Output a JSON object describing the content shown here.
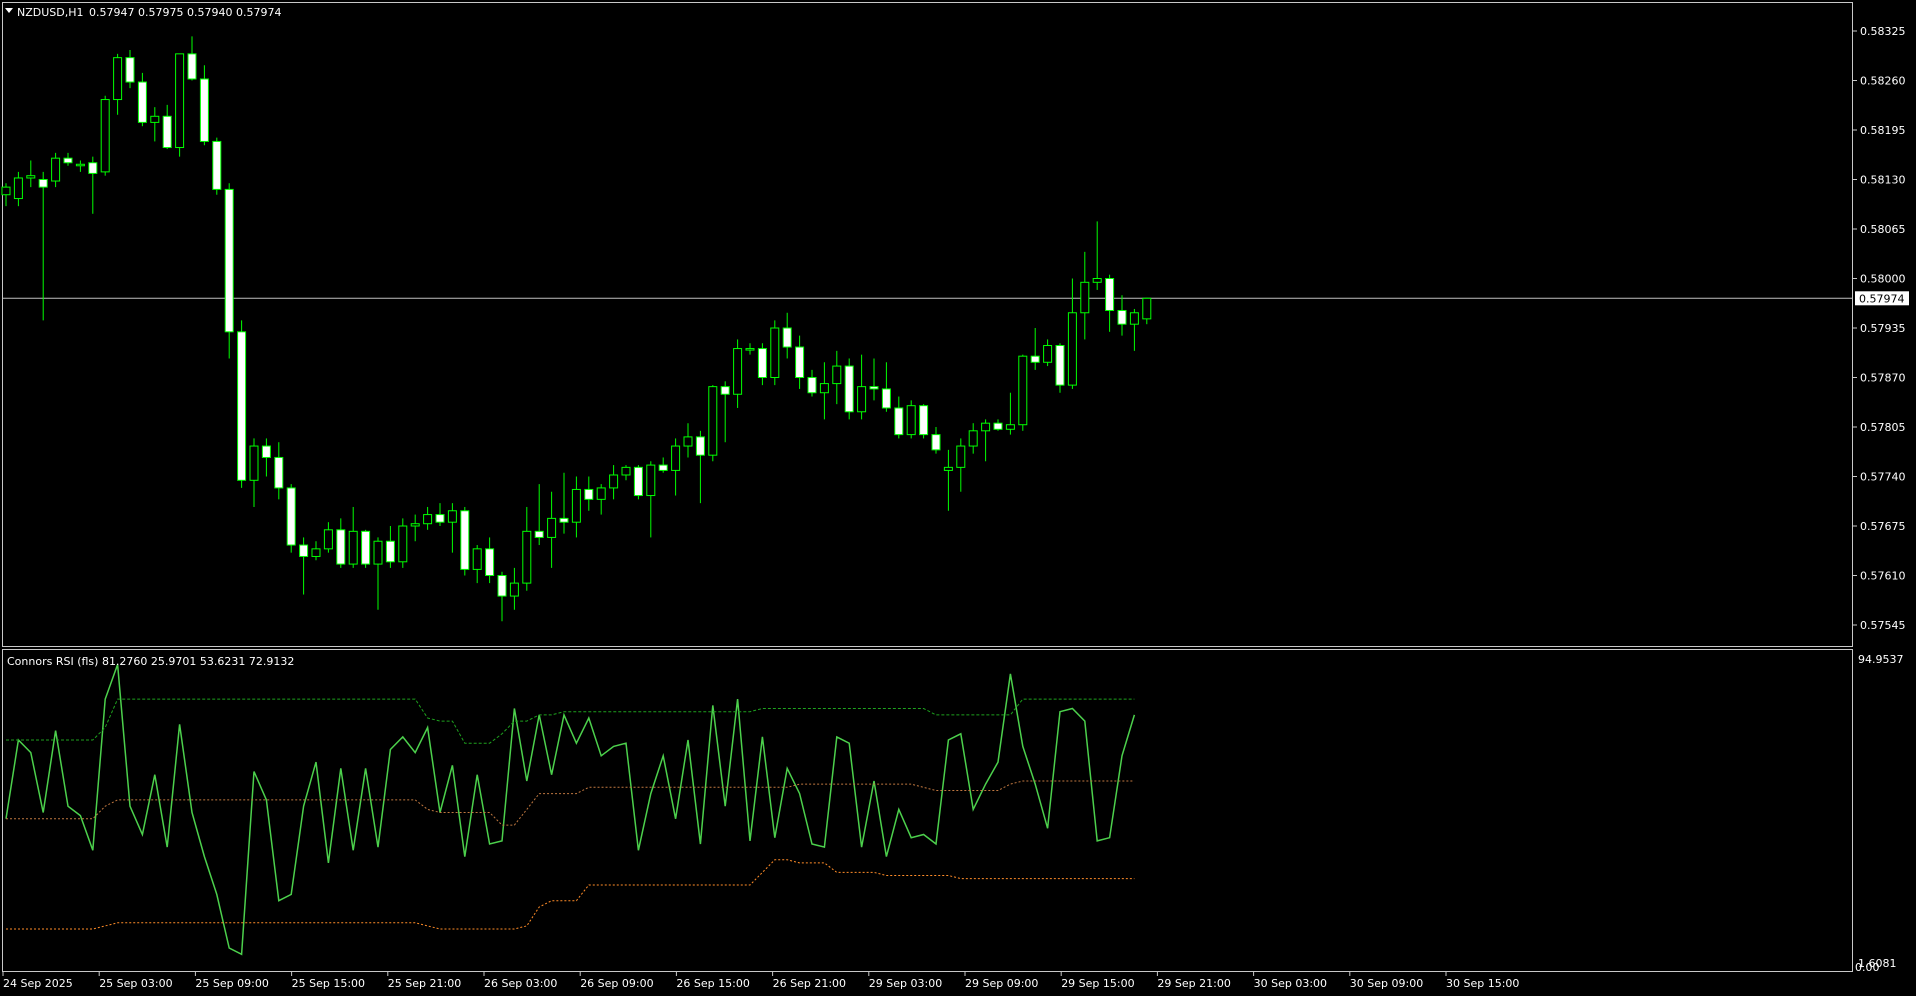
{
  "header": {
    "symbol_label": "NZDUSD,H1",
    "ohlc_label": "0.57947 0.57975 0.57940 0.57974",
    "dropdown_icon": "triangle-down-icon"
  },
  "indicator": {
    "label": "Connors RSI (fls) 81.2760 25.9701 53.6231 72.9132",
    "axis_max_label": "94.9537",
    "axis_min_label": "1.6081",
    "axis_zero_label": "0.00"
  },
  "colors": {
    "background": "#000000",
    "candle": "#00ff00",
    "bull_body": "#000000",
    "bear_body": "#ffffff",
    "frame": "#c8c8c8",
    "current_price_line": "#c0c0c0",
    "rsi_line": "#4cd04c",
    "upper_band": "#1ea01e",
    "mid_band": "#c07840",
    "lower_band": "#ff8c28"
  },
  "chart_data": [
    {
      "type": "candlestick",
      "title": "NZDUSD,H1",
      "y_ticks": [
        "0.58325",
        "0.58260",
        "0.58195",
        "0.58130",
        "0.58065",
        "0.58000",
        "0.57935",
        "0.57870",
        "0.57805",
        "0.57740",
        "0.57675",
        "0.57610",
        "0.57545"
      ],
      "current_price_label": "0.57974",
      "current_price": 0.57974,
      "x_ticks": [
        "24 Sep 2025",
        "25 Sep 03:00",
        "25 Sep 09:00",
        "25 Sep 15:00",
        "25 Sep 21:00",
        "26 Sep 03:00",
        "26 Sep 09:00",
        "26 Sep 15:00",
        "26 Sep 21:00",
        "29 Sep 03:00",
        "29 Sep 09:00",
        "29 Sep 15:00",
        "29 Sep 21:00",
        "30 Sep 03:00",
        "30 Sep 09:00",
        "30 Sep 15:00"
      ],
      "ohlc": [
        [
          0.5811,
          0.58125,
          0.58095,
          0.5812
        ],
        [
          0.58105,
          0.5814,
          0.58095,
          0.58132
        ],
        [
          0.58132,
          0.58155,
          0.5812,
          0.58135
        ],
        [
          0.5813,
          0.5814,
          0.57945,
          0.5812
        ],
        [
          0.58128,
          0.58165,
          0.5812,
          0.58158
        ],
        [
          0.58158,
          0.58165,
          0.58148,
          0.58152
        ],
        [
          0.5815,
          0.58155,
          0.5814,
          0.5815
        ],
        [
          0.58152,
          0.5816,
          0.58085,
          0.58138
        ],
        [
          0.5814,
          0.5824,
          0.58135,
          0.58235
        ],
        [
          0.58235,
          0.58295,
          0.58215,
          0.5829
        ],
        [
          0.5829,
          0.583,
          0.5825,
          0.58258
        ],
        [
          0.58258,
          0.5827,
          0.582,
          0.58205
        ],
        [
          0.58205,
          0.58225,
          0.5818,
          0.58213
        ],
        [
          0.58213,
          0.58228,
          0.5817,
          0.58172
        ],
        [
          0.58172,
          0.58295,
          0.5816,
          0.58295
        ],
        [
          0.58295,
          0.58318,
          0.5826,
          0.58262
        ],
        [
          0.58262,
          0.5828,
          0.58175,
          0.5818
        ],
        [
          0.5818,
          0.58185,
          0.5811,
          0.58117
        ],
        [
          0.58117,
          0.58125,
          0.57895,
          0.5793
        ],
        [
          0.5793,
          0.57945,
          0.57725,
          0.57735
        ],
        [
          0.57735,
          0.5779,
          0.577,
          0.5778
        ],
        [
          0.5778,
          0.5779,
          0.5774,
          0.57765
        ],
        [
          0.57765,
          0.57785,
          0.5771,
          0.57725
        ],
        [
          0.57725,
          0.5773,
          0.5764,
          0.5765
        ],
        [
          0.5765,
          0.5766,
          0.57585,
          0.57635
        ],
        [
          0.57635,
          0.57655,
          0.5763,
          0.57645
        ],
        [
          0.57645,
          0.5768,
          0.5764,
          0.5767
        ],
        [
          0.5767,
          0.57685,
          0.5762,
          0.57625
        ],
        [
          0.57625,
          0.577,
          0.5762,
          0.57668
        ],
        [
          0.57668,
          0.5767,
          0.5762,
          0.57625
        ],
        [
          0.57625,
          0.5766,
          0.57565,
          0.57655
        ],
        [
          0.57655,
          0.57675,
          0.5762,
          0.57628
        ],
        [
          0.57628,
          0.57685,
          0.5762,
          0.57675
        ],
        [
          0.57675,
          0.5769,
          0.57655,
          0.57678
        ],
        [
          0.57678,
          0.577,
          0.5767,
          0.5769
        ],
        [
          0.5769,
          0.57705,
          0.57675,
          0.5768
        ],
        [
          0.5768,
          0.57705,
          0.5764,
          0.57695
        ],
        [
          0.57695,
          0.577,
          0.5761,
          0.57618
        ],
        [
          0.57618,
          0.5765,
          0.576,
          0.57645
        ],
        [
          0.57645,
          0.5766,
          0.576,
          0.5761
        ],
        [
          0.5761,
          0.57615,
          0.5755,
          0.57583
        ],
        [
          0.57583,
          0.5762,
          0.57565,
          0.576
        ],
        [
          0.576,
          0.577,
          0.5759,
          0.57668
        ],
        [
          0.57668,
          0.5773,
          0.5765,
          0.5766
        ],
        [
          0.5766,
          0.5772,
          0.5762,
          0.57685
        ],
        [
          0.57685,
          0.57745,
          0.57665,
          0.5768
        ],
        [
          0.5768,
          0.5774,
          0.5766,
          0.57723
        ],
        [
          0.57723,
          0.5774,
          0.57695,
          0.5771
        ],
        [
          0.5771,
          0.5773,
          0.5769,
          0.57725
        ],
        [
          0.57725,
          0.57755,
          0.5771,
          0.57742
        ],
        [
          0.57742,
          0.57755,
          0.57735,
          0.57752
        ],
        [
          0.57752,
          0.57755,
          0.5771,
          0.57715
        ],
        [
          0.57715,
          0.5776,
          0.5766,
          0.57755
        ],
        [
          0.57755,
          0.57765,
          0.57745,
          0.57748
        ],
        [
          0.57748,
          0.5779,
          0.57715,
          0.5778
        ],
        [
          0.5778,
          0.5781,
          0.57765,
          0.57792
        ],
        [
          0.57792,
          0.578,
          0.57705,
          0.57768
        ],
        [
          0.57768,
          0.5786,
          0.5776,
          0.57858
        ],
        [
          0.57858,
          0.57865,
          0.57785,
          0.57848
        ],
        [
          0.57848,
          0.5792,
          0.5783,
          0.57908
        ],
        [
          0.57908,
          0.57915,
          0.579,
          0.57908
        ],
        [
          0.57908,
          0.57915,
          0.5786,
          0.5787
        ],
        [
          0.5787,
          0.57945,
          0.5786,
          0.57935
        ],
        [
          0.57935,
          0.57955,
          0.57895,
          0.5791
        ],
        [
          0.5791,
          0.57925,
          0.57855,
          0.5787
        ],
        [
          0.5787,
          0.5788,
          0.57845,
          0.5785
        ],
        [
          0.5785,
          0.5789,
          0.57815,
          0.57862
        ],
        [
          0.57862,
          0.57905,
          0.57835,
          0.57885
        ],
        [
          0.57885,
          0.57895,
          0.57815,
          0.57825
        ],
        [
          0.57825,
          0.579,
          0.57815,
          0.57858
        ],
        [
          0.57858,
          0.57895,
          0.5784,
          0.57855
        ],
        [
          0.57855,
          0.5789,
          0.57825,
          0.5783
        ],
        [
          0.5783,
          0.57845,
          0.5779,
          0.57795
        ],
        [
          0.57795,
          0.5784,
          0.5779,
          0.57833
        ],
        [
          0.57833,
          0.57835,
          0.5779,
          0.57795
        ],
        [
          0.57795,
          0.57805,
          0.5777,
          0.57775
        ],
        [
          0.57748,
          0.57775,
          0.57695,
          0.57752
        ],
        [
          0.57752,
          0.5779,
          0.5772,
          0.5778
        ],
        [
          0.5778,
          0.5781,
          0.5777,
          0.578
        ],
        [
          0.578,
          0.57815,
          0.5776,
          0.5781
        ],
        [
          0.5781,
          0.57815,
          0.578,
          0.57802
        ],
        [
          0.57802,
          0.5785,
          0.57795,
          0.57808
        ],
        [
          0.57808,
          0.579,
          0.578,
          0.57898
        ],
        [
          0.57898,
          0.57935,
          0.5788,
          0.5789
        ],
        [
          0.5789,
          0.5792,
          0.57885,
          0.57912
        ],
        [
          0.57912,
          0.57915,
          0.5785,
          0.5786
        ],
        [
          0.5786,
          0.58,
          0.57855,
          0.57955
        ],
        [
          0.57955,
          0.58035,
          0.5792,
          0.57995
        ],
        [
          0.57995,
          0.58075,
          0.57985,
          0.58
        ],
        [
          0.58,
          0.58005,
          0.5793,
          0.57958
        ],
        [
          0.57958,
          0.57978,
          0.57925,
          0.5794
        ],
        [
          0.5794,
          0.5796,
          0.57905,
          0.57955
        ],
        [
          0.57947,
          0.57975,
          0.5794,
          0.57974
        ]
      ]
    },
    {
      "type": "line",
      "title": "Connors RSI (fls) 81.2760 25.9701 53.6231 72.9132",
      "ylim": [
        0,
        100
      ],
      "series": [
        {
          "role": "rsi",
          "values": [
            48,
            73,
            69,
            50,
            76,
            52,
            49,
            38,
            86,
            97,
            52,
            43,
            62,
            39,
            78,
            50,
            36,
            24,
            7,
            5,
            63,
            54,
            22,
            24,
            52,
            66,
            34,
            64,
            38,
            64,
            39,
            70,
            74,
            69,
            77,
            50,
            65,
            36,
            62,
            40,
            41,
            83,
            60,
            81,
            62,
            81,
            72,
            80,
            68,
            71,
            72,
            38,
            56,
            68,
            48,
            73,
            40,
            84,
            52,
            86,
            41,
            74,
            42,
            64,
            56,
            40,
            39,
            74,
            72,
            39,
            60,
            36,
            51,
            42,
            43,
            40,
            73,
            75,
            51,
            59,
            66,
            94,
            71,
            59,
            45,
            82,
            83,
            79,
            41,
            42,
            68,
            81
          ]
        },
        {
          "role": "upper-band",
          "values": [
            73,
            73,
            73,
            73,
            73,
            73,
            73,
            73,
            77,
            86,
            86,
            86,
            86,
            86,
            86,
            86,
            86,
            86,
            86,
            86,
            86,
            86,
            86,
            86,
            86,
            86,
            86,
            86,
            86,
            86,
            86,
            86,
            86,
            86,
            80,
            79,
            79,
            72,
            72,
            72,
            75,
            79,
            79,
            81,
            81,
            82,
            82,
            82,
            82,
            82,
            82,
            82,
            82,
            82,
            82,
            82,
            82,
            82,
            82,
            82,
            82,
            83,
            83,
            83,
            83,
            83,
            83,
            83,
            83,
            83,
            83,
            83,
            83,
            83,
            83,
            81,
            81,
            81,
            81,
            81,
            81,
            81,
            86,
            86,
            86,
            86,
            86,
            86,
            86,
            86,
            86,
            86
          ]
        },
        {
          "role": "mid-band",
          "values": [
            48,
            48,
            48,
            48,
            48,
            48,
            48,
            48,
            52,
            54,
            54,
            54,
            54,
            54,
            54,
            54,
            54,
            54,
            54,
            54,
            54,
            54,
            54,
            54,
            54,
            54,
            54,
            54,
            54,
            54,
            54,
            54,
            54,
            54,
            51,
            50,
            50,
            50,
            50,
            50,
            46,
            46,
            51,
            56,
            56,
            56,
            56,
            58,
            58,
            58,
            58,
            58,
            58,
            58,
            58,
            58,
            58,
            58,
            58,
            58,
            58,
            58,
            58,
            58,
            59,
            59,
            59,
            59,
            59,
            59,
            59,
            59,
            59,
            59,
            58,
            57,
            57,
            57,
            57,
            57,
            57,
            59,
            60,
            60,
            60,
            60,
            60,
            60,
            60,
            60,
            60,
            60
          ]
        },
        {
          "role": "lower-band",
          "values": [
            13,
            13,
            13,
            13,
            13,
            13,
            13,
            13,
            14,
            15,
            15,
            15,
            15,
            15,
            15,
            15,
            15,
            15,
            15,
            15,
            15,
            15,
            15,
            15,
            15,
            15,
            15,
            15,
            15,
            15,
            15,
            15,
            15,
            15,
            14,
            13,
            13,
            13,
            13,
            13,
            13,
            13,
            14,
            20,
            22,
            22,
            22,
            27,
            27,
            27,
            27,
            27,
            27,
            27,
            27,
            27,
            27,
            27,
            27,
            27,
            27,
            31,
            35,
            35,
            34,
            34,
            34,
            31,
            31,
            31,
            31,
            30,
            30,
            30,
            30,
            30,
            30,
            29,
            29,
            29,
            29,
            29,
            29,
            29,
            29,
            29,
            29,
            29,
            29,
            29,
            29,
            29
          ]
        }
      ]
    }
  ]
}
